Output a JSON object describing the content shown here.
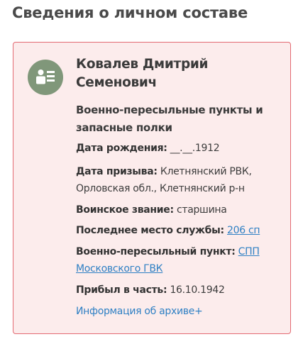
{
  "section_title": "Сведения о личном составе",
  "person": {
    "name": "Ковалев Дмитрий Семенович",
    "unit": "Военно-пересыльные пункты и запасные полки"
  },
  "fields": {
    "birth_date": {
      "label": "Дата рождения:",
      "value": "__.__.1912"
    },
    "draft_date": {
      "label": "Дата призыва:",
      "value": "Клетнянский РВК, Орловская обл., Клетнянский р-н"
    },
    "rank": {
      "label": "Воинское звание:",
      "value": "старшина"
    },
    "last_service": {
      "label": "Последнее место службы:",
      "value": "206 сп"
    },
    "transit_point": {
      "label": "Военно-пересыльный пункт:",
      "value": "СПП Московского ГВК"
    },
    "arrived": {
      "label": "Прибыл в часть:",
      "value": "16.10.1942"
    }
  },
  "archive_link": "Информация об архиве+",
  "icons": {
    "avatar": "person-card-icon"
  },
  "colors": {
    "card_background": "#fcecec",
    "card_border": "#e36a72",
    "avatar_background": "#80977a",
    "link": "#2f80c4"
  }
}
